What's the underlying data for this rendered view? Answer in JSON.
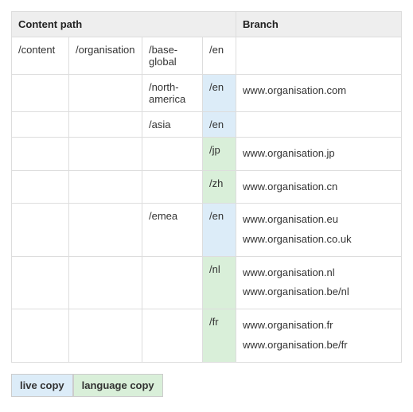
{
  "headers": {
    "content_path": "Content path",
    "branch": "Branch"
  },
  "rows": [
    {
      "c1": "/content",
      "c2": "/organisation",
      "c3": "/base-global",
      "c4": "/en",
      "c4_class": "",
      "b1": "",
      "b2": ""
    },
    {
      "c1": "",
      "c2": "",
      "c3": "/north-america",
      "c4": "/en",
      "c4_class": "live",
      "b1": "www.organisation.com",
      "b2": ""
    },
    {
      "c1": "",
      "c2": "",
      "c3": "/asia",
      "c4": "/en",
      "c4_class": "live",
      "b1": "",
      "b2": ""
    },
    {
      "c1": "",
      "c2": "",
      "c3": "",
      "c4": "/jp",
      "c4_class": "lang",
      "b1": "www.organisation.jp",
      "b2": ""
    },
    {
      "c1": "",
      "c2": "",
      "c3": "",
      "c4": "/zh",
      "c4_class": "lang",
      "b1": "www.organisation.cn",
      "b2": ""
    },
    {
      "c1": "",
      "c2": "",
      "c3": "/emea",
      "c4": "/en",
      "c4_class": "live",
      "b1": "www.organisation.eu",
      "b2": "www.organisation.co.uk"
    },
    {
      "c1": "",
      "c2": "",
      "c3": "",
      "c4": "/nl",
      "c4_class": "lang",
      "b1": "www.organisation.nl",
      "b2": "www.organisation.be/nl"
    },
    {
      "c1": "",
      "c2": "",
      "c3": "",
      "c4": "/fr",
      "c4_class": "lang",
      "b1": "www.organisation.fr",
      "b2": "www.organisation.be/fr"
    }
  ],
  "legend": {
    "live_copy": "live copy",
    "language_copy": "language copy"
  },
  "colors": {
    "live": "#dcecf8",
    "lang": "#d9efd9"
  }
}
